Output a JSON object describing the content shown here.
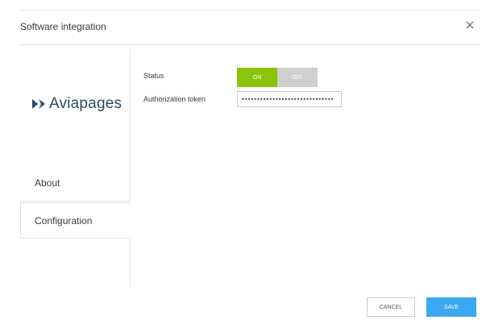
{
  "dialog": {
    "title": "Software integration",
    "close_icon": "close-icon"
  },
  "sidebar": {
    "logo_text": "Aviapages",
    "logo_icon": "aviapages-logo-icon",
    "items": [
      {
        "label": "About",
        "active": false
      },
      {
        "label": "Configuration",
        "active": true
      }
    ]
  },
  "form": {
    "status_label": "Status",
    "status_on_label": "ON",
    "status_off_label": "OFF",
    "status_value": "ON",
    "token_label": "Authorization token",
    "token_value": "••••••••••••••••••••••••••••••"
  },
  "footer": {
    "cancel_label": "CANCEL",
    "save_label": "SAVE"
  },
  "colors": {
    "toggle_on": "#8bc20b",
    "toggle_off": "#cfcfcf",
    "save_button": "#3aa9f0",
    "logo_text": "#2b4b64"
  }
}
